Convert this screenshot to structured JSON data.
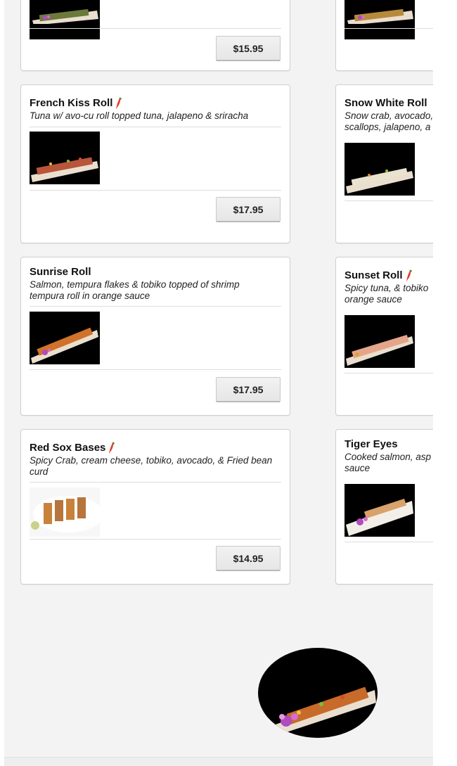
{
  "colors": {
    "panel_bg": "#f3f3f3",
    "card_border": "#cfcfcf",
    "pepper": "#e53b2c"
  },
  "cards": [
    {
      "name": "",
      "description": "",
      "price": "$15.95",
      "spicy": false,
      "image": "sushi-roll-plate-icon"
    },
    {
      "name": "",
      "description": "",
      "price": "",
      "spicy": false,
      "image": "sushi-roll-plate-icon"
    },
    {
      "name": "French Kiss Roll",
      "description": "Tuna w/ avo-cu roll topped tuna, jalapeno & sriracha",
      "price": "$17.95",
      "spicy": true,
      "image": "sushi-roll-plate-icon"
    },
    {
      "name": "Snow White Roll",
      "description": "Snow crab, avocado, scallops, jalapeno, a",
      "price": "",
      "spicy": false,
      "image": "sushi-roll-plate-icon"
    },
    {
      "name": "Sunrise Roll",
      "description": "Salmon, tempura flakes & tobiko topped of shrimp tempura roll in orange sauce",
      "price": "$17.95",
      "spicy": false,
      "image": "sushi-roll-plate-icon"
    },
    {
      "name": "Sunset Roll",
      "description": "Spicy tuna, & tobiko orange sauce",
      "price": "",
      "spicy": true,
      "image": "sushi-roll-plate-icon"
    },
    {
      "name": "Red Sox Bases",
      "description": "Spicy Crab, cream cheese, tobiko, avocado, & Fried bean curd",
      "price": "$14.95",
      "spicy": true,
      "image": "sushi-roll-white-plate-icon"
    },
    {
      "name": "Tiger Eyes",
      "description": "Cooked salmon, asp sauce",
      "price": "",
      "spicy": false,
      "image": "sushi-roll-plate-icon"
    }
  ]
}
